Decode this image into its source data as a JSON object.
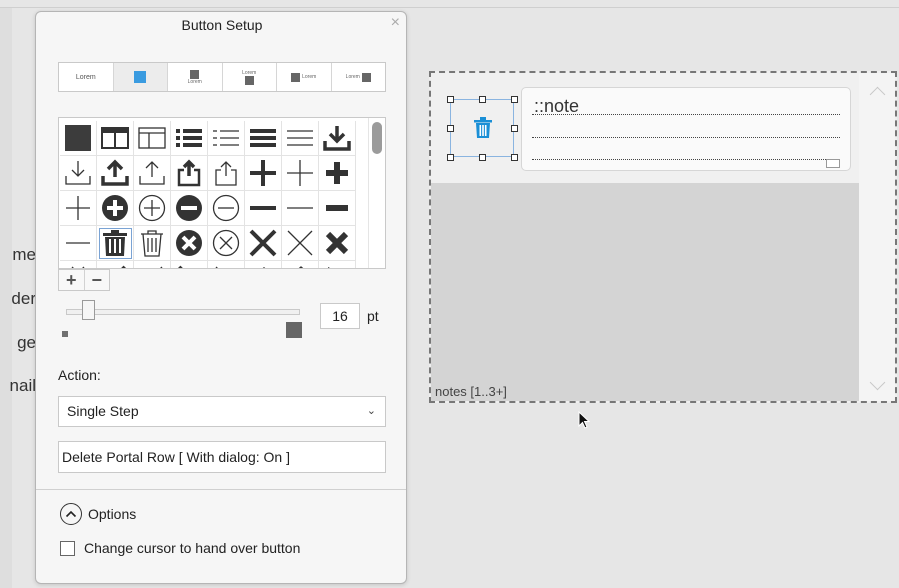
{
  "dialog": {
    "title": "Button Setup",
    "close_glyph": "×",
    "style_options": [
      {
        "label": "Lorem",
        "kind": "text"
      },
      {
        "label": "",
        "kind": "blue-square"
      },
      {
        "label": "Lorem",
        "kind": "icon-top"
      },
      {
        "label": "Lorem",
        "kind": "icon-bottom"
      },
      {
        "label": "Lorem",
        "kind": "icon-left"
      },
      {
        "label": "Lorem",
        "kind": "icon-right"
      }
    ],
    "icon_grid": {
      "icons": [
        "square-fill-icon",
        "table-header-icon",
        "table-icon",
        "list-bold-icon",
        "list-dashed-icon",
        "lines-bold-icon",
        "lines-thin-icon",
        "download-bold-icon",
        "download-thin-icon",
        "upload-bold-icon",
        "upload-thin-icon",
        "share-bold-icon",
        "share-thin-icon",
        "plus-bold-icon",
        "plus-thin-icon",
        "plus-heavy-icon",
        "plus-light-icon",
        "plus-circle-fill-icon",
        "plus-circle-outline-icon",
        "minus-circle-fill-icon",
        "minus-circle-outline-icon",
        "minus-bold-icon",
        "minus-thin-icon",
        "minus-heavy-icon",
        "minus-light-icon",
        "trash-bold-icon",
        "trash-thin-icon",
        "x-circle-fill-icon",
        "x-circle-outline-icon",
        "x-bold-icon",
        "x-thin-icon",
        "x-heavy-icon"
      ],
      "selected_index": 25,
      "add_label": "+",
      "remove_label": "−"
    },
    "icon_size": {
      "value": "16",
      "unit": "pt",
      "slider_level": 0.07
    },
    "action": {
      "label": "Action:",
      "selected": "Single Step",
      "step": "Delete Portal Row [ With dialog: On ]"
    },
    "options_label": "Options",
    "cursor_hand_label": "Change cursor to hand over button",
    "cursor_hand_checked": false
  },
  "background": {
    "field_labels": [
      "me",
      "der",
      "ge",
      "nail"
    ],
    "portal": {
      "note_field_text": "::note",
      "portal_label": "notes [1..3+]"
    }
  },
  "colors": {
    "accent_blue": "#1a8fd6",
    "selection_border": "#8ab4e0"
  }
}
